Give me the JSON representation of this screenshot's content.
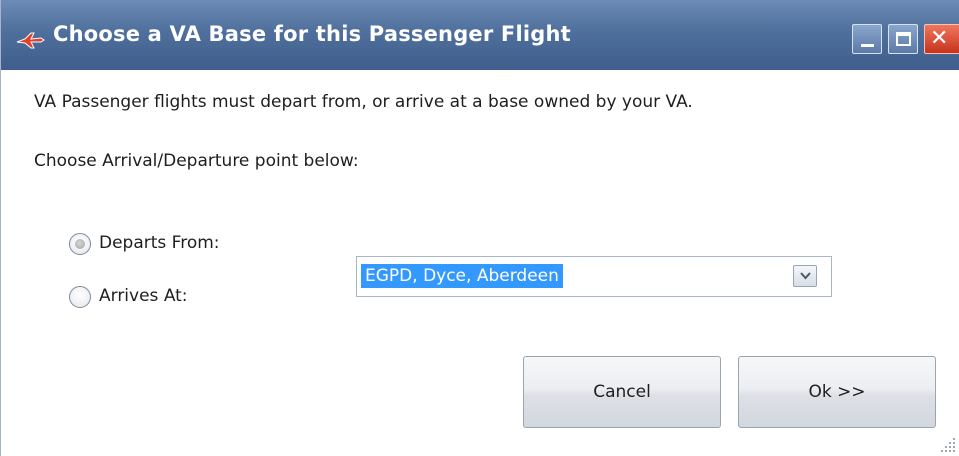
{
  "window": {
    "title": "Choose a VA Base for this Passenger Flight",
    "icon": "plane-icon",
    "controls": {
      "minimize_icon": "minimize-icon",
      "maximize_icon": "maximize-icon",
      "close_glyph": "✕"
    }
  },
  "body": {
    "message": "VA Passenger flights must depart from, or arrive at a base owned by your VA.",
    "instruction": "Choose Arrival/Departure point below:"
  },
  "options": {
    "departs_label": "Departs From:",
    "arrives_label": "Arrives At:",
    "selected": "departs"
  },
  "base_select": {
    "value": "EGPD, Dyce, Aberdeen",
    "dropdown_icon": "chevron-down-icon"
  },
  "buttons": {
    "cancel_label": "Cancel",
    "ok_label": "Ok >>"
  },
  "colors": {
    "titlebar": "#4f6f9c",
    "selection": "#3399ff",
    "close_button": "#c8321c"
  }
}
